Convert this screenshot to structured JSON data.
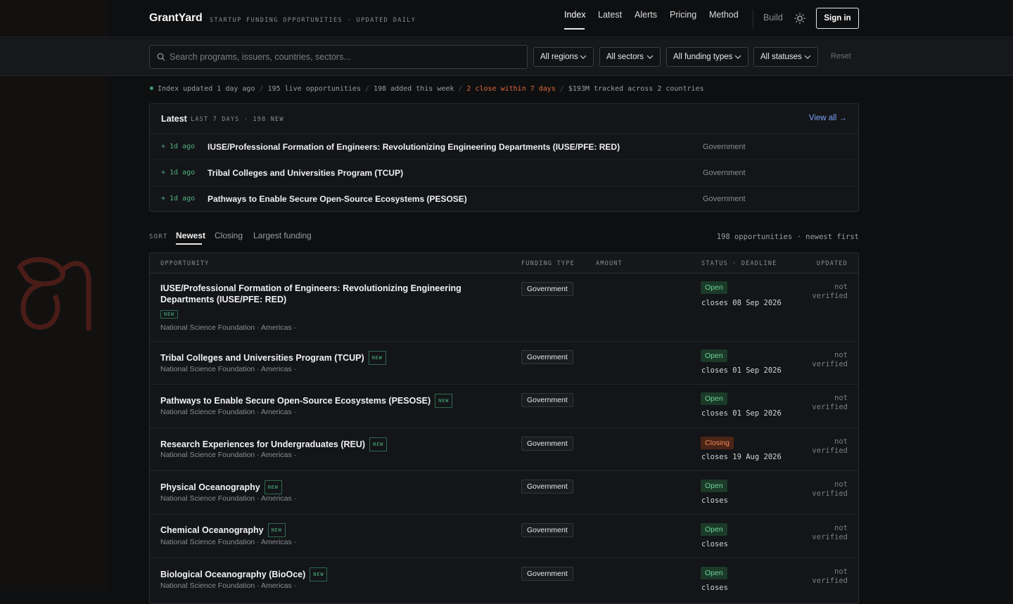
{
  "header": {
    "brand": "GrantYard",
    "tagline": "STARTUP FUNDING OPPORTUNITIES · UPDATED DAILY",
    "nav": [
      "Index",
      "Latest",
      "Alerts",
      "Pricing",
      "Method"
    ],
    "build": "Build",
    "signin": "Sign in"
  },
  "filters": {
    "search_placeholder": "Search programs, issuers, countries, sectors...",
    "regions": "All regions",
    "sectors": "All sectors",
    "funding_types": "All funding types",
    "statuses": "All statuses",
    "reset": "Reset"
  },
  "status": {
    "updated": "Index updated 1 day ago",
    "live": "195 live opportunities",
    "added": "198 added this week",
    "closing": "2 close within 7 days",
    "tracked": "$193M tracked across 2 countries"
  },
  "latest": {
    "title": "Latest",
    "subtitle": "LAST 7 DAYS · 198 NEW",
    "view_all": "View all →",
    "rows": [
      {
        "time": "+ 1d ago",
        "title": "IUSE/Professional Formation of Engineers: Revolutionizing Engineering Departments (IUSE/PFE: RED)",
        "type": "Government"
      },
      {
        "time": "+ 1d ago",
        "title": "Tribal Colleges and Universities Program (TCUP)",
        "type": "Government"
      },
      {
        "time": "+ 1d ago",
        "title": "Pathways to Enable Secure Open-Source Ecosystems (PESOSE)",
        "type": "Government"
      }
    ]
  },
  "sort": {
    "label": "SORT",
    "tabs": [
      "Newest",
      "Closing",
      "Largest funding"
    ],
    "count": "198 opportunities · newest first"
  },
  "table": {
    "headers": {
      "opportunity": "OPPORTUNITY",
      "funding_type": "FUNDING TYPE",
      "amount": "AMOUNT",
      "status_deadline": "STATUS · DEADLINE",
      "updated": "UPDATED"
    },
    "new_label": "NEW",
    "rows": [
      {
        "title": "IUSE/Professional Formation of Engineers: Revolutionizing Engineering Departments (IUSE/PFE: RED)",
        "meta": "National Science Foundation · Americas ·",
        "type": "Government",
        "status": "Open",
        "deadline": "closes 08 Sep 2026",
        "updated_1": "not",
        "updated_2": "verified"
      },
      {
        "title": "Tribal Colleges and Universities Program (TCUP)",
        "meta": "National Science Foundation · Americas ·",
        "type": "Government",
        "status": "Open",
        "deadline": "closes 01 Sep 2026",
        "updated_1": "not",
        "updated_2": "verified"
      },
      {
        "title": "Pathways to Enable Secure Open-Source Ecosystems (PESOSE)",
        "meta": "National Science Foundation · Americas ·",
        "type": "Government",
        "status": "Open",
        "deadline": "closes 01 Sep 2026",
        "updated_1": "not",
        "updated_2": "verified"
      },
      {
        "title": "Research Experiences for Undergraduates (REU)",
        "meta": "National Science Foundation · Americas ·",
        "type": "Government",
        "status": "Closing",
        "deadline": "closes 19 Aug 2026",
        "updated_1": "not",
        "updated_2": "verified"
      },
      {
        "title": "Physical Oceanography",
        "meta": "National Science Foundation · Americas ·",
        "type": "Government",
        "status": "Open",
        "deadline": "closes",
        "updated_1": "not",
        "updated_2": "verified"
      },
      {
        "title": "Chemical Oceanography",
        "meta": "National Science Foundation · Americas ·",
        "type": "Government",
        "status": "Open",
        "deadline": "closes",
        "updated_1": "not",
        "updated_2": "verified"
      },
      {
        "title": "Biological Oceanography (BioOce)",
        "meta": "National Science Foundation · Americas ·",
        "type": "Government",
        "status": "Open",
        "deadline": "closes",
        "updated_1": "not",
        "updated_2": "verified"
      }
    ]
  },
  "colors": {
    "accent_link": "#7aa2f7",
    "new_green": "#4fb27e",
    "closing_orange": "#e0693a",
    "decor_red": "#5a1e1a"
  }
}
